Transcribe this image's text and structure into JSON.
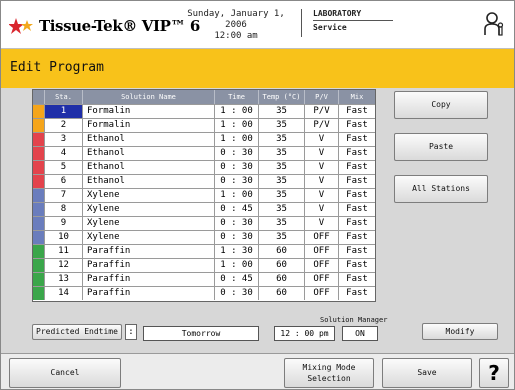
{
  "header": {
    "logo_text": "Tissue-Tek® VIP™ 6",
    "date": "Sunday, January 1, 2006",
    "time": "12:00 am",
    "area": "LABORATORY",
    "role": "Service",
    "user_icon": "user-key-icon"
  },
  "title": "Edit Program",
  "table": {
    "columns": [
      "Sta.",
      "Solution Name",
      "Time",
      "Temp (°C)",
      "P/V",
      "Mix"
    ],
    "rows": [
      {
        "color": "#f5a51b",
        "sta": "1",
        "name": "Formalin",
        "time": "1 : 00",
        "temp": "35",
        "pv": "P/V",
        "mix": "Fast"
      },
      {
        "color": "#f5a51b",
        "sta": "2",
        "name": "Formalin",
        "time": "1 : 00",
        "temp": "35",
        "pv": "P/V",
        "mix": "Fast"
      },
      {
        "color": "#e3434c",
        "sta": "3",
        "name": "Ethanol",
        "time": "1 : 00",
        "temp": "35",
        "pv": "V",
        "mix": "Fast"
      },
      {
        "color": "#e3434c",
        "sta": "4",
        "name": "Ethanol",
        "time": "0 : 30",
        "temp": "35",
        "pv": "V",
        "mix": "Fast"
      },
      {
        "color": "#e3434c",
        "sta": "5",
        "name": "Ethanol",
        "time": "0 : 30",
        "temp": "35",
        "pv": "V",
        "mix": "Fast"
      },
      {
        "color": "#e3434c",
        "sta": "6",
        "name": "Ethanol",
        "time": "0 : 30",
        "temp": "35",
        "pv": "V",
        "mix": "Fast"
      },
      {
        "color": "#6a7dbd",
        "sta": "7",
        "name": "Xylene",
        "time": "1 : 00",
        "temp": "35",
        "pv": "V",
        "mix": "Fast"
      },
      {
        "color": "#6a7dbd",
        "sta": "8",
        "name": "Xylene",
        "time": "0 : 45",
        "temp": "35",
        "pv": "V",
        "mix": "Fast"
      },
      {
        "color": "#6a7dbd",
        "sta": "9",
        "name": "Xylene",
        "time": "0 : 30",
        "temp": "35",
        "pv": "V",
        "mix": "Fast"
      },
      {
        "color": "#6a7dbd",
        "sta": "10",
        "name": "Xylene",
        "time": "0 : 30",
        "temp": "35",
        "pv": "OFF",
        "mix": "Fast"
      },
      {
        "color": "#3aa64a",
        "sta": "11",
        "name": "Paraffin",
        "time": "1 : 30",
        "temp": "60",
        "pv": "OFF",
        "mix": "Fast"
      },
      {
        "color": "#3aa64a",
        "sta": "12",
        "name": "Paraffin",
        "time": "1 : 00",
        "temp": "60",
        "pv": "OFF",
        "mix": "Fast"
      },
      {
        "color": "#3aa64a",
        "sta": "13",
        "name": "Paraffin",
        "time": "0 : 45",
        "temp": "60",
        "pv": "OFF",
        "mix": "Fast"
      },
      {
        "color": "#3aa64a",
        "sta": "14",
        "name": "Paraffin",
        "time": "0 : 30",
        "temp": "60",
        "pv": "OFF",
        "mix": "Fast"
      }
    ]
  },
  "side_buttons": {
    "copy": "Copy",
    "paste": "Paste",
    "all_stations": "All Stations"
  },
  "endtime": {
    "label": "Predicted Endtime",
    "colon": ":",
    "day": "Tomorrow",
    "time": "12 : 00 pm"
  },
  "solution_manager": {
    "label": "Solution Manager",
    "value": "ON",
    "modify": "Modify"
  },
  "footer": {
    "cancel": "Cancel",
    "mixing": "Mixing Mode\nSelection",
    "save": "Save",
    "help": "?"
  }
}
